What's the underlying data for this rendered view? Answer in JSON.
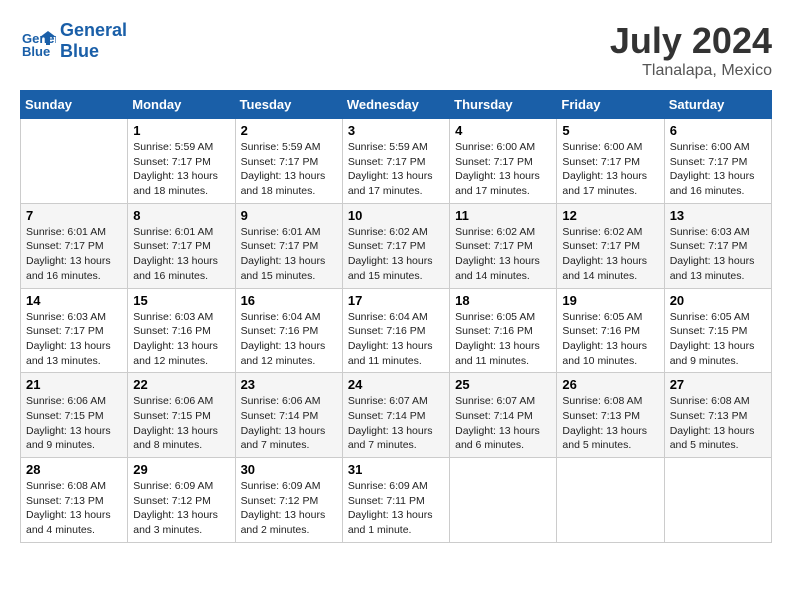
{
  "header": {
    "logo_line1": "General",
    "logo_line2": "Blue",
    "month": "July 2024",
    "location": "Tlanalapa, Mexico"
  },
  "weekdays": [
    "Sunday",
    "Monday",
    "Tuesday",
    "Wednesday",
    "Thursday",
    "Friday",
    "Saturday"
  ],
  "weeks": [
    [
      {
        "day": "",
        "info": ""
      },
      {
        "day": "1",
        "info": "Sunrise: 5:59 AM\nSunset: 7:17 PM\nDaylight: 13 hours\nand 18 minutes."
      },
      {
        "day": "2",
        "info": "Sunrise: 5:59 AM\nSunset: 7:17 PM\nDaylight: 13 hours\nand 18 minutes."
      },
      {
        "day": "3",
        "info": "Sunrise: 5:59 AM\nSunset: 7:17 PM\nDaylight: 13 hours\nand 17 minutes."
      },
      {
        "day": "4",
        "info": "Sunrise: 6:00 AM\nSunset: 7:17 PM\nDaylight: 13 hours\nand 17 minutes."
      },
      {
        "day": "5",
        "info": "Sunrise: 6:00 AM\nSunset: 7:17 PM\nDaylight: 13 hours\nand 17 minutes."
      },
      {
        "day": "6",
        "info": "Sunrise: 6:00 AM\nSunset: 7:17 PM\nDaylight: 13 hours\nand 16 minutes."
      }
    ],
    [
      {
        "day": "7",
        "info": "Sunrise: 6:01 AM\nSunset: 7:17 PM\nDaylight: 13 hours\nand 16 minutes."
      },
      {
        "day": "8",
        "info": "Sunrise: 6:01 AM\nSunset: 7:17 PM\nDaylight: 13 hours\nand 16 minutes."
      },
      {
        "day": "9",
        "info": "Sunrise: 6:01 AM\nSunset: 7:17 PM\nDaylight: 13 hours\nand 15 minutes."
      },
      {
        "day": "10",
        "info": "Sunrise: 6:02 AM\nSunset: 7:17 PM\nDaylight: 13 hours\nand 15 minutes."
      },
      {
        "day": "11",
        "info": "Sunrise: 6:02 AM\nSunset: 7:17 PM\nDaylight: 13 hours\nand 14 minutes."
      },
      {
        "day": "12",
        "info": "Sunrise: 6:02 AM\nSunset: 7:17 PM\nDaylight: 13 hours\nand 14 minutes."
      },
      {
        "day": "13",
        "info": "Sunrise: 6:03 AM\nSunset: 7:17 PM\nDaylight: 13 hours\nand 13 minutes."
      }
    ],
    [
      {
        "day": "14",
        "info": "Sunrise: 6:03 AM\nSunset: 7:17 PM\nDaylight: 13 hours\nand 13 minutes."
      },
      {
        "day": "15",
        "info": "Sunrise: 6:03 AM\nSunset: 7:16 PM\nDaylight: 13 hours\nand 12 minutes."
      },
      {
        "day": "16",
        "info": "Sunrise: 6:04 AM\nSunset: 7:16 PM\nDaylight: 13 hours\nand 12 minutes."
      },
      {
        "day": "17",
        "info": "Sunrise: 6:04 AM\nSunset: 7:16 PM\nDaylight: 13 hours\nand 11 minutes."
      },
      {
        "day": "18",
        "info": "Sunrise: 6:05 AM\nSunset: 7:16 PM\nDaylight: 13 hours\nand 11 minutes."
      },
      {
        "day": "19",
        "info": "Sunrise: 6:05 AM\nSunset: 7:16 PM\nDaylight: 13 hours\nand 10 minutes."
      },
      {
        "day": "20",
        "info": "Sunrise: 6:05 AM\nSunset: 7:15 PM\nDaylight: 13 hours\nand 9 minutes."
      }
    ],
    [
      {
        "day": "21",
        "info": "Sunrise: 6:06 AM\nSunset: 7:15 PM\nDaylight: 13 hours\nand 9 minutes."
      },
      {
        "day": "22",
        "info": "Sunrise: 6:06 AM\nSunset: 7:15 PM\nDaylight: 13 hours\nand 8 minutes."
      },
      {
        "day": "23",
        "info": "Sunrise: 6:06 AM\nSunset: 7:14 PM\nDaylight: 13 hours\nand 7 minutes."
      },
      {
        "day": "24",
        "info": "Sunrise: 6:07 AM\nSunset: 7:14 PM\nDaylight: 13 hours\nand 7 minutes."
      },
      {
        "day": "25",
        "info": "Sunrise: 6:07 AM\nSunset: 7:14 PM\nDaylight: 13 hours\nand 6 minutes."
      },
      {
        "day": "26",
        "info": "Sunrise: 6:08 AM\nSunset: 7:13 PM\nDaylight: 13 hours\nand 5 minutes."
      },
      {
        "day": "27",
        "info": "Sunrise: 6:08 AM\nSunset: 7:13 PM\nDaylight: 13 hours\nand 5 minutes."
      }
    ],
    [
      {
        "day": "28",
        "info": "Sunrise: 6:08 AM\nSunset: 7:13 PM\nDaylight: 13 hours\nand 4 minutes."
      },
      {
        "day": "29",
        "info": "Sunrise: 6:09 AM\nSunset: 7:12 PM\nDaylight: 13 hours\nand 3 minutes."
      },
      {
        "day": "30",
        "info": "Sunrise: 6:09 AM\nSunset: 7:12 PM\nDaylight: 13 hours\nand 2 minutes."
      },
      {
        "day": "31",
        "info": "Sunrise: 6:09 AM\nSunset: 7:11 PM\nDaylight: 13 hours\nand 1 minute."
      },
      {
        "day": "",
        "info": ""
      },
      {
        "day": "",
        "info": ""
      },
      {
        "day": "",
        "info": ""
      }
    ]
  ]
}
